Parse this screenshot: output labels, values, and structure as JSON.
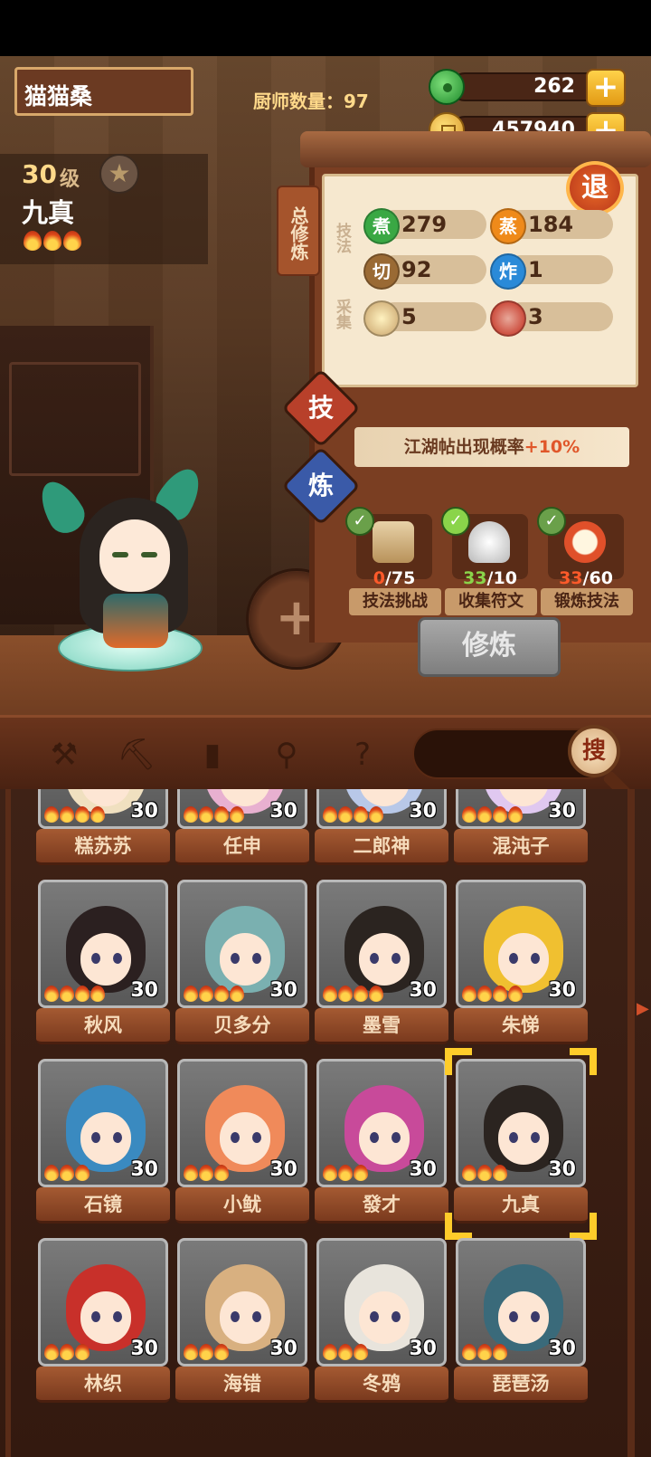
{
  "header": {
    "player_name": "猫猫桑",
    "chef_count": "厨师数量：97"
  },
  "currency": {
    "jade": "262",
    "coins": "457940",
    "jade_icon": "jade-icon",
    "coin_icon": "coin-icon",
    "plus_label": "+"
  },
  "selected_chef": {
    "level": "30",
    "level_unit": "级",
    "name": "九真",
    "star_icon": "★"
  },
  "panel": {
    "tab_label": "总修炼",
    "retreat_label": "退",
    "technique_label": "技法",
    "gather_label": "采集",
    "skills": [
      {
        "badge": "煮",
        "value": "279",
        "color": "#3aa844"
      },
      {
        "badge": "蒸",
        "value": "184",
        "color": "#ef8a1a"
      },
      {
        "badge": "切",
        "value": "92",
        "color": "#9a6a34"
      },
      {
        "badge": "炸",
        "value": "1",
        "color": "#2a8ad8"
      },
      {
        "badge": "",
        "value": "5",
        "icon": "rice-icon"
      },
      {
        "badge": "",
        "value": "3",
        "icon": "meat-icon"
      }
    ],
    "diamond_skill": "技",
    "diamond_train": "炼",
    "banner_text": "江湖帖出现概率",
    "banner_bonus": "+10%",
    "tasks": [
      {
        "done": "0",
        "total": "/75",
        "label": "技法挑战",
        "icon": "scroll-icon"
      },
      {
        "done": "33",
        "total": "/10",
        "label": "收集符文",
        "icon": "rune-icon"
      },
      {
        "done": "33",
        "total": "/60",
        "label": "锻炼技法",
        "icon": "alarm-clock-icon"
      }
    ],
    "train_button": "修炼",
    "add_button": "+"
  },
  "toolbar": {
    "search_label": "搜",
    "tools": [
      "shovel-icon",
      "pickaxe-icon",
      "jar-icon",
      "location-pin-icon",
      "map-question-icon"
    ]
  },
  "roster": {
    "level": "30",
    "rows": [
      [
        "糕苏苏",
        "任申",
        "二郎神",
        "混沌子"
      ],
      [
        "秋风",
        "贝多分",
        "墨雪",
        "朱悌"
      ],
      [
        "石镜",
        "小鱿",
        "發才",
        "九真"
      ],
      [
        "林织",
        "海错",
        "冬鸦",
        "琵琶汤"
      ]
    ],
    "selected": "九真"
  }
}
